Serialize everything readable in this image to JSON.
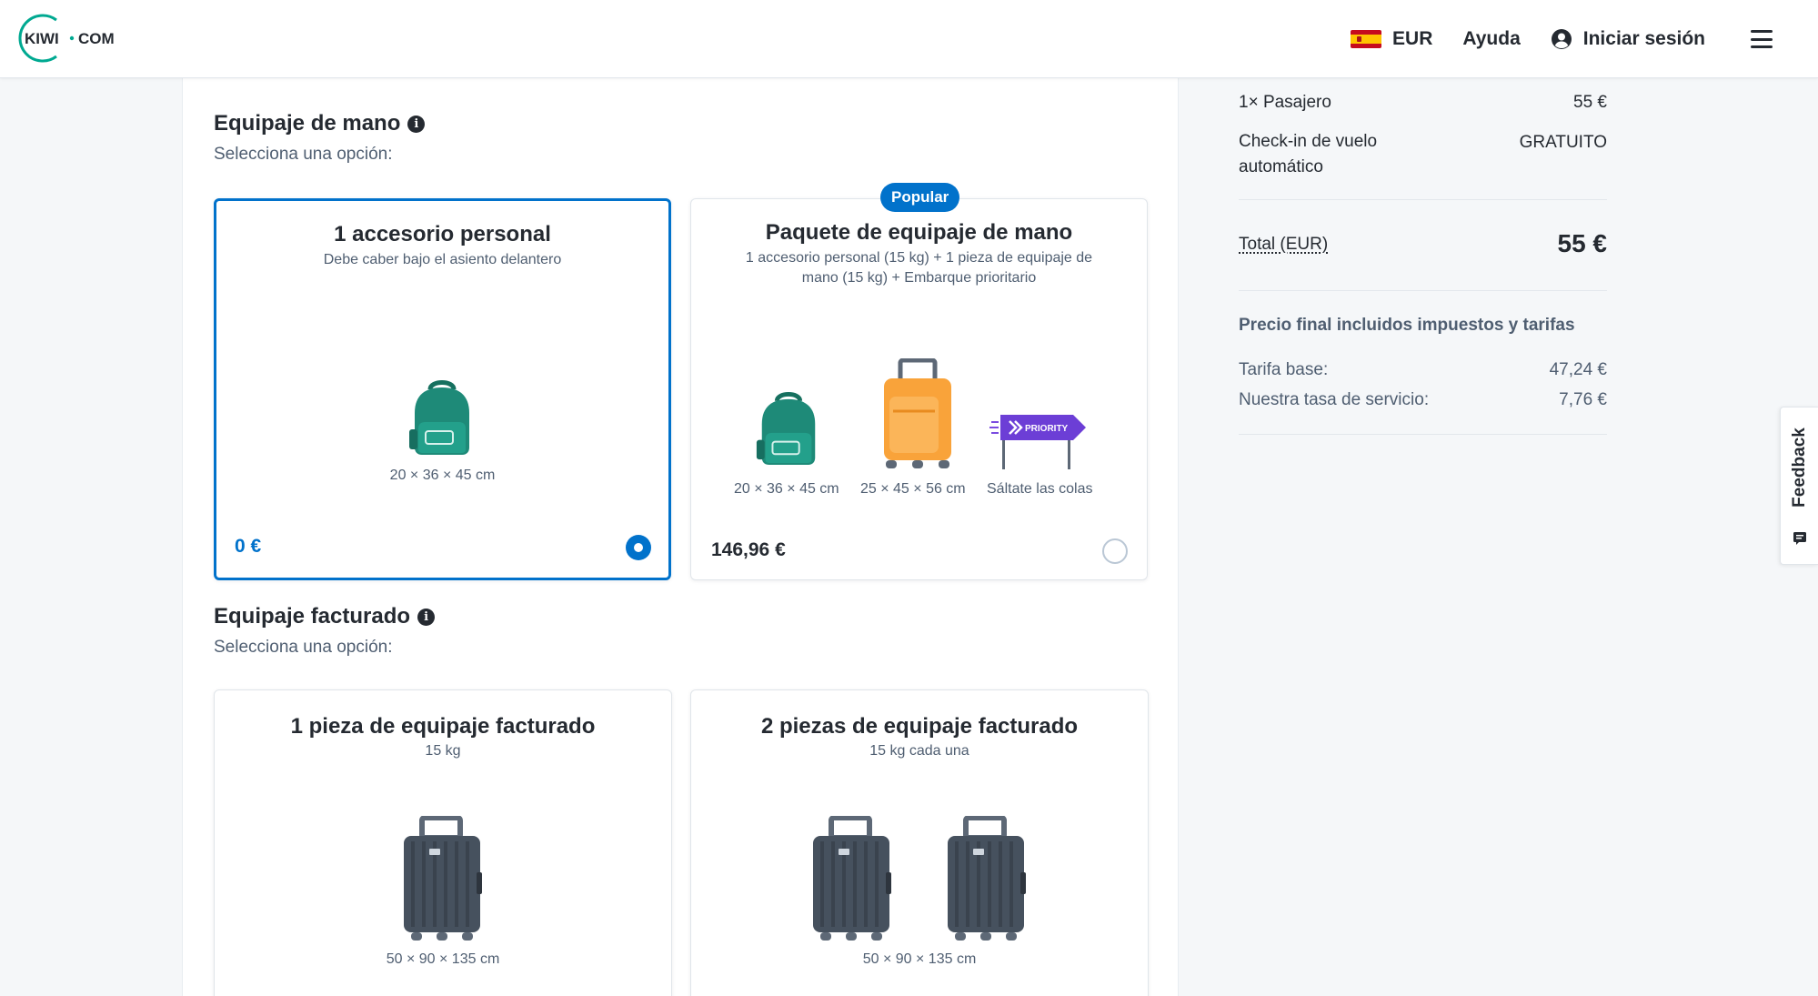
{
  "header": {
    "logo_text": "KIWI·COM",
    "currency": "EUR",
    "help": "Ayuda",
    "login": "Iniciar sesión"
  },
  "cabin": {
    "title": "Equipaje de mano",
    "subtitle": "Selecciona una opción:",
    "options": [
      {
        "title": "1 accesorio personal",
        "description": "Debe caber bajo el asiento delantero",
        "items": [
          "20 × 36 × 45 cm"
        ],
        "price": "0 €",
        "selected": true
      },
      {
        "badge": "Popular",
        "title": "Paquete de equipaje de mano",
        "description": "1 accesorio personal (15 kg) + 1 pieza de equipaje de mano (15 kg) + Embarque prioritario",
        "items": [
          "20 × 36 × 45 cm",
          "25 × 45 × 56 cm",
          "Sáltate las colas"
        ],
        "sign_text": "PRIORITY",
        "price": "146,96 €",
        "selected": false
      }
    ]
  },
  "checked": {
    "title": "Equipaje facturado",
    "subtitle": "Selecciona una opción:",
    "options": [
      {
        "title": "1 pieza de equipaje facturado",
        "description": "15 kg",
        "dimensions": "50 × 90 × 135 cm"
      },
      {
        "title": "2 piezas de equipaje facturado",
        "description": "15 kg cada una",
        "dimensions": "50 × 90 × 135 cm"
      }
    ]
  },
  "summary": {
    "passenger_label": "1× Pasajero",
    "passenger_price": "55 €",
    "checkin_label": "Check-in de vuelo automático",
    "checkin_value": "GRATUITO",
    "total_label": "Total (EUR)",
    "total_value": "55 €",
    "final_note": "Precio final incluidos impuestos y tarifas",
    "base_fare_label": "Tarifa base:",
    "base_fare_value": "47,24 €",
    "service_fee_label": "Nuestra tasa de servicio:",
    "service_fee_value": "7,76 €"
  },
  "feedback": {
    "label": "Feedback"
  },
  "colors": {
    "accent": "#0172cb",
    "teal": "#00a991",
    "text": "#252a31",
    "secondary": "#4f5e71",
    "bag_teal": "#1e8a78",
    "suitcase_orange": "#f9a33a",
    "suitcase_dark": "#46515e",
    "priority_purple": "#6c3ed6"
  }
}
